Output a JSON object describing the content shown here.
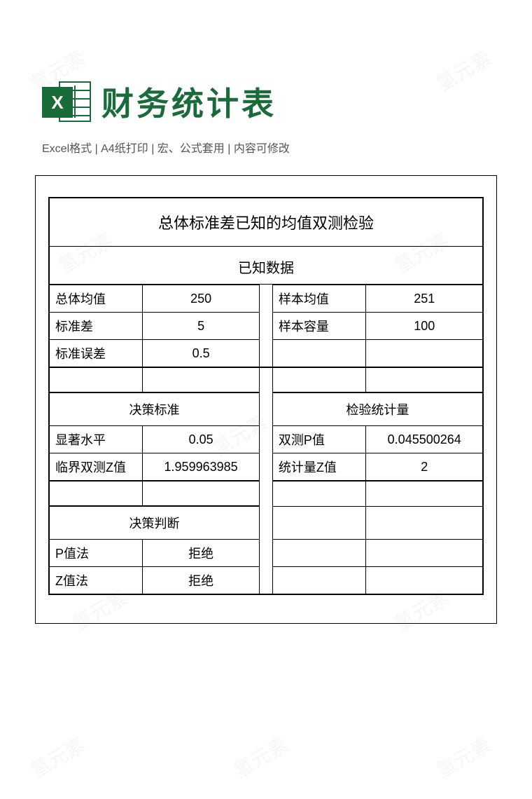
{
  "header": {
    "title": "财务统计表",
    "icon_letter": "X",
    "subtitle": "Excel格式 |  A4纸打印 | 宏、公式套用 | 内容可修改"
  },
  "sheet": {
    "title": "总体标准差已知的均值双测检验",
    "known_data_header": "已知数据",
    "known": {
      "pop_mean_label": "总体均值",
      "pop_mean_value": "250",
      "stddev_label": "标准差",
      "stddev_value": "5",
      "stderr_label": "标准误差",
      "stderr_value": "0.5",
      "sample_mean_label": "样本均值",
      "sample_mean_value": "251",
      "sample_size_label": "样本容量",
      "sample_size_value": "100"
    },
    "decision_header": "决策标准",
    "teststat_header": "检验统计量",
    "decision": {
      "sig_label": "显著水平",
      "sig_value": "0.05",
      "critz_label": "临界双测Z值",
      "critz_value": "1.959963985"
    },
    "teststat": {
      "pval_label": "双测P值",
      "pval_value": "0.045500264",
      "zstat_label": "统计量Z值",
      "zstat_value": "2"
    },
    "judge_header": "决策判断",
    "judge": {
      "p_label": "P值法",
      "p_value": "拒绝",
      "z_label": "Z值法",
      "z_value": "拒绝"
    }
  },
  "watermark_text": "氢元素"
}
